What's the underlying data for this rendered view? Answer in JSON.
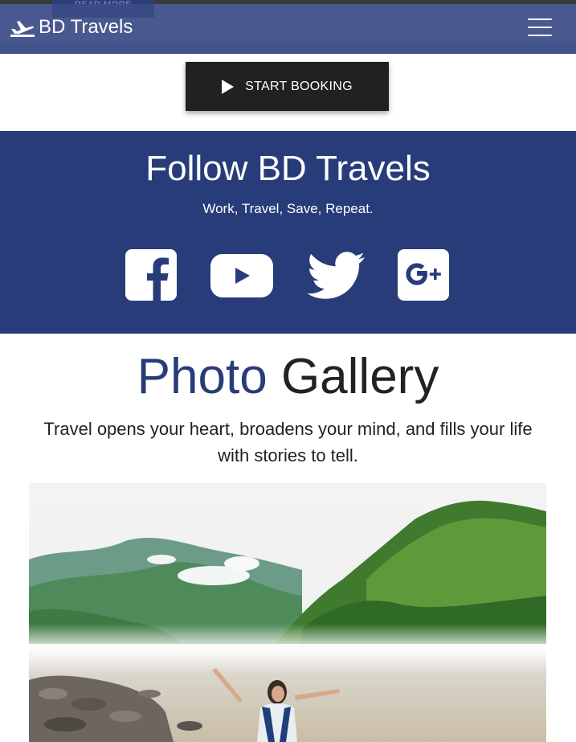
{
  "navbar": {
    "ghost_button_label": "READ MORE",
    "brand": "BD Travels",
    "brand_icon": "plane-icon",
    "menu_icon": "hamburger-menu-icon"
  },
  "cta": {
    "label": "START BOOKING",
    "icon": "play-icon"
  },
  "follow": {
    "title": "Follow BD Travels",
    "tagline": "Work, Travel, Save, Repeat.",
    "background": "#283c7a",
    "socials": [
      "facebook-icon",
      "youtube-icon",
      "twitter-icon",
      "google-plus-icon"
    ]
  },
  "gallery": {
    "title_accent": "Photo",
    "title_rest": "Gallery",
    "subtitle": "Travel opens your heart, broadens your mind, and fills your life with stories to tell."
  },
  "colors": {
    "navbar": "#324380",
    "accent": "#283c7a",
    "cta": "#212121"
  }
}
